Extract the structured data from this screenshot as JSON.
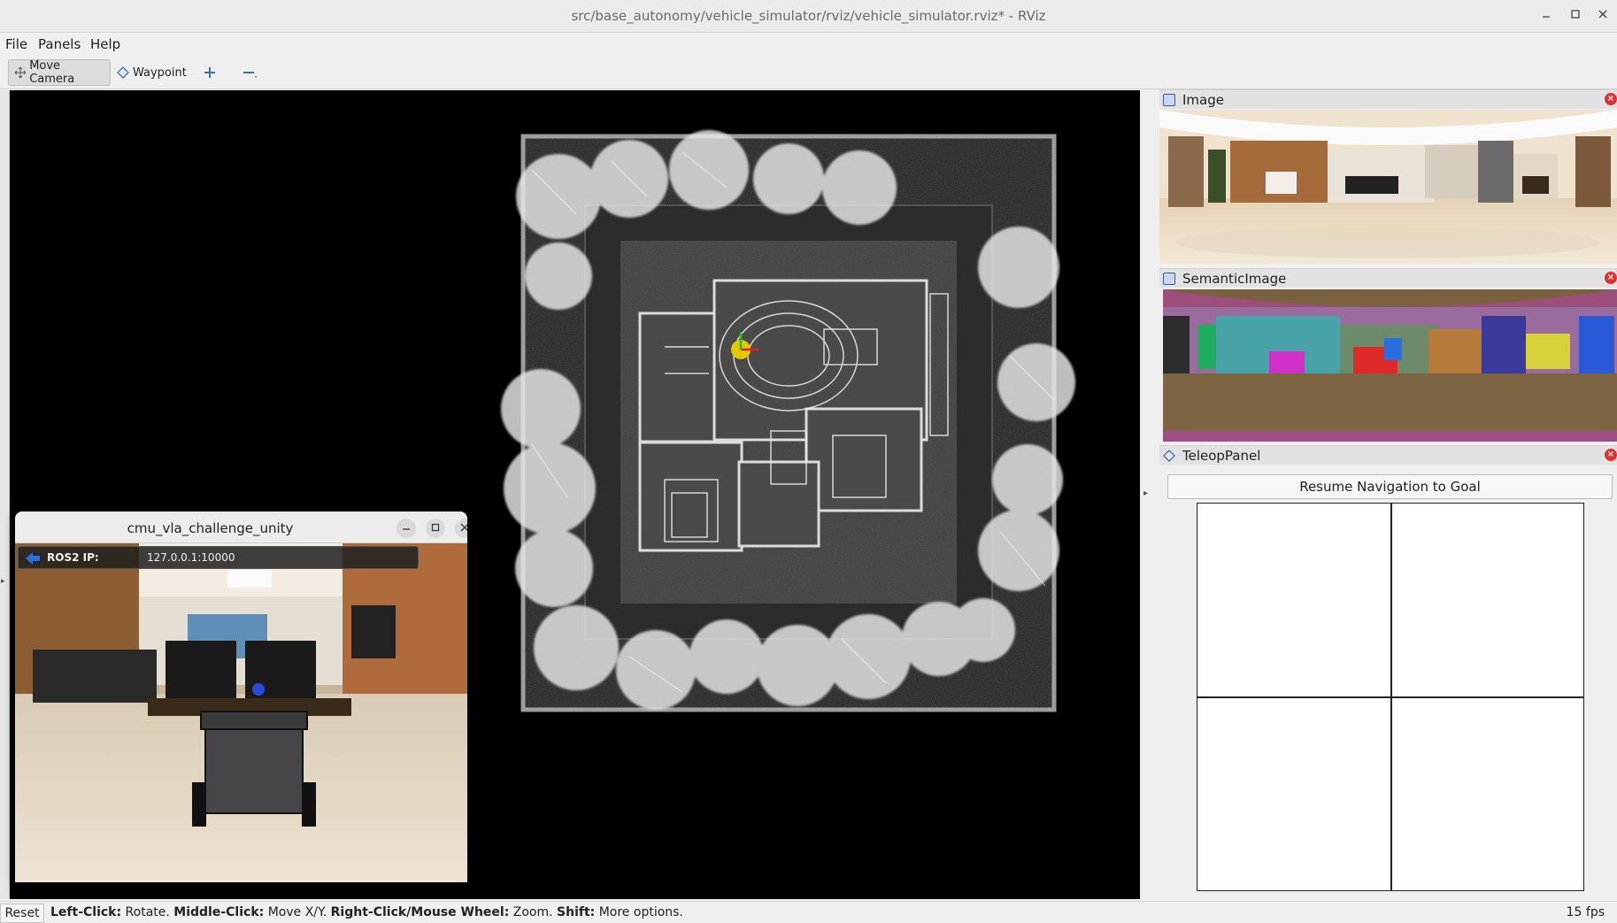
{
  "window": {
    "title": "src/base_autonomy/vehicle_simulator/rviz/vehicle_simulator.rviz* - RViz"
  },
  "menu": {
    "file": "File",
    "panels": "Panels",
    "help": "Help"
  },
  "toolbar": {
    "move_camera": "Move Camera",
    "waypoint": "Waypoint",
    "plus_icon": "plus-icon",
    "minus_icon": "minus-icon"
  },
  "panels": {
    "image": {
      "title": "Image"
    },
    "semantic": {
      "title": "SemanticImage"
    },
    "teleop": {
      "title": "TeleopPanel",
      "resume_label": "Resume Navigation to Goal"
    }
  },
  "statusbar": {
    "reset": "Reset",
    "left_click_key": "Left-Click:",
    "left_click_val": " Rotate. ",
    "middle_click_key": "Middle-Click:",
    "middle_click_val": " Move X/Y. ",
    "right_click_key": "Right-Click/Mouse Wheel:",
    "right_click_val": " Zoom. ",
    "shift_key": "Shift:",
    "shift_val": " More options.",
    "fps": "15 fps"
  },
  "unity": {
    "title": "cmu_vla_challenge_unity",
    "ros_label": "ROS2 IP:",
    "ros_ip": "127.0.0.1:10000"
  },
  "colors": {
    "render_bg": "#000000",
    "accent": "#3b6fb4",
    "close_red": "#e03030"
  }
}
